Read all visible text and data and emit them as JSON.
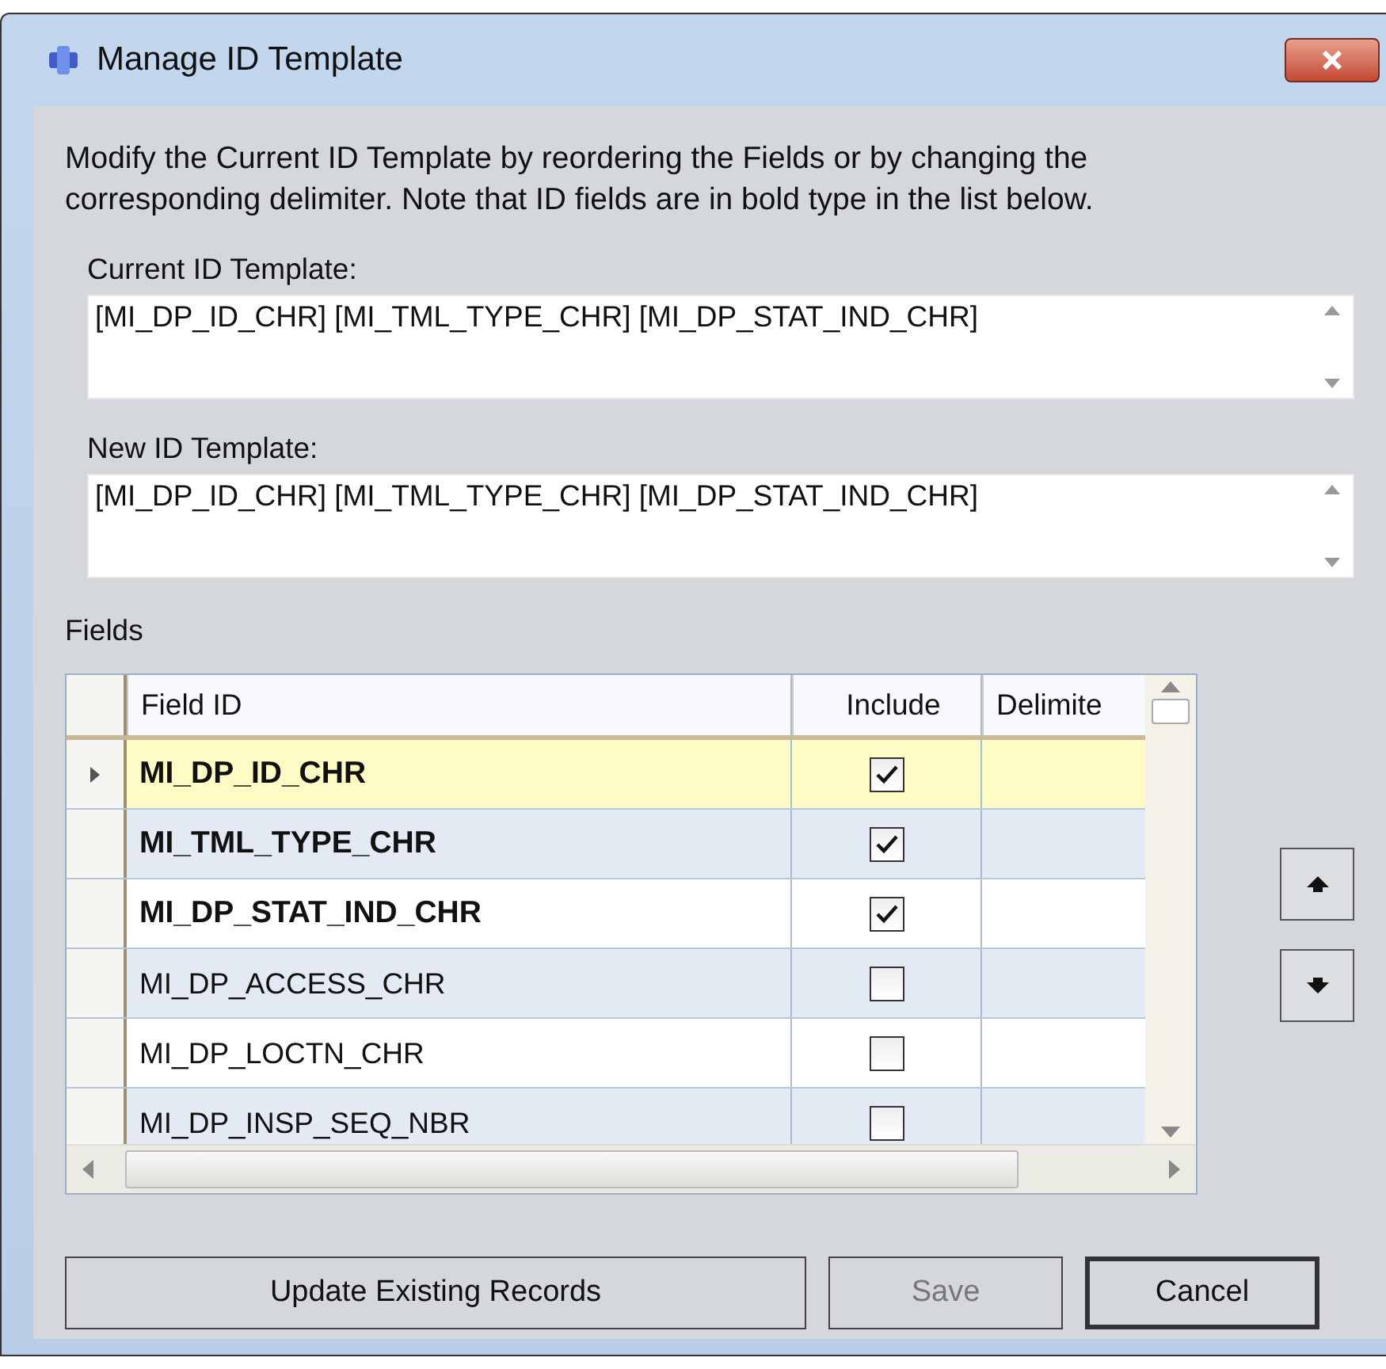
{
  "window": {
    "title": "Manage ID Template"
  },
  "instructions": "Modify the Current ID Template by reordering the Fields or by changing the corresponding delimiter.  Note that ID fields are in bold type in the list below.",
  "templates": [
    {
      "label": "Current ID Template:",
      "value": "[MI_DP_ID_CHR] [MI_TML_TYPE_CHR] [MI_DP_STAT_IND_CHR]"
    },
    {
      "label": "New ID Template:",
      "value": "[MI_DP_ID_CHR] [MI_TML_TYPE_CHR] [MI_DP_STAT_IND_CHR]"
    }
  ],
  "fields_label": "Fields",
  "table": {
    "columns": [
      "Field ID",
      "Include",
      "Delimite"
    ],
    "rows": [
      {
        "field_id": "MI_DP_ID_CHR",
        "bold": true,
        "include": true,
        "selected": true
      },
      {
        "field_id": "MI_TML_TYPE_CHR",
        "bold": true,
        "include": true,
        "selected": false
      },
      {
        "field_id": "MI_DP_STAT_IND_CHR",
        "bold": true,
        "include": true,
        "selected": false
      },
      {
        "field_id": "MI_DP_ACCESS_CHR",
        "bold": false,
        "include": false,
        "selected": false
      },
      {
        "field_id": "MI_DP_LOCTN_CHR",
        "bold": false,
        "include": false,
        "selected": false
      },
      {
        "field_id": "MI_DP_INSP_SEQ_NBR",
        "bold": false,
        "include": false,
        "selected": false
      }
    ]
  },
  "buttons": [
    {
      "label": "Update Existing Records",
      "disabled": false,
      "default": false
    },
    {
      "label": "Save",
      "disabled": true,
      "default": false
    },
    {
      "label": "Cancel",
      "disabled": false,
      "default": true
    }
  ]
}
